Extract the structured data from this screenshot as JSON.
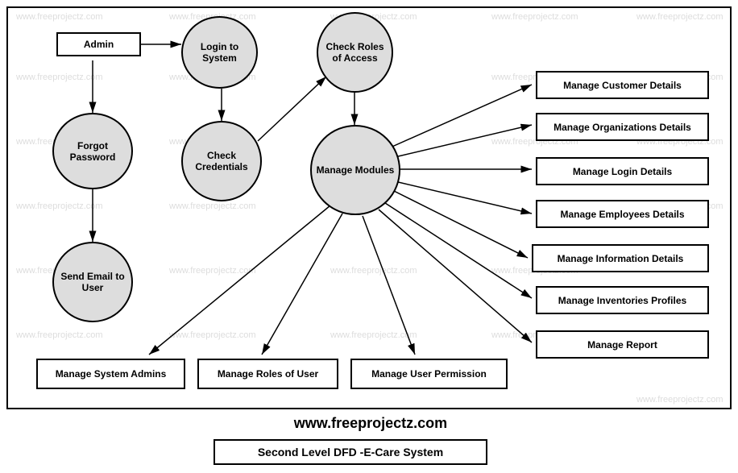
{
  "nodes": {
    "admin": "Admin",
    "login": "Login to System",
    "forgot": "Forgot Password",
    "credentials": "Check Credentials",
    "roles": "Check Roles of Access",
    "send_email": "Send Email to User",
    "modules": "Manage Modules"
  },
  "right_boxes": [
    "Manage Customer Details",
    "Manage Organizations Details",
    "Manage Login Details",
    "Manage Employees Details",
    "Manage Information Details",
    "Manage Inventories Profiles",
    "Manage  Report"
  ],
  "bottom_boxes": [
    "Manage System Admins",
    "Manage Roles of User",
    "Manage User Permission"
  ],
  "footer": "www.freeprojectz.com",
  "title": "Second Level DFD -E-Care System",
  "watermark": "www.freeprojectz.com"
}
